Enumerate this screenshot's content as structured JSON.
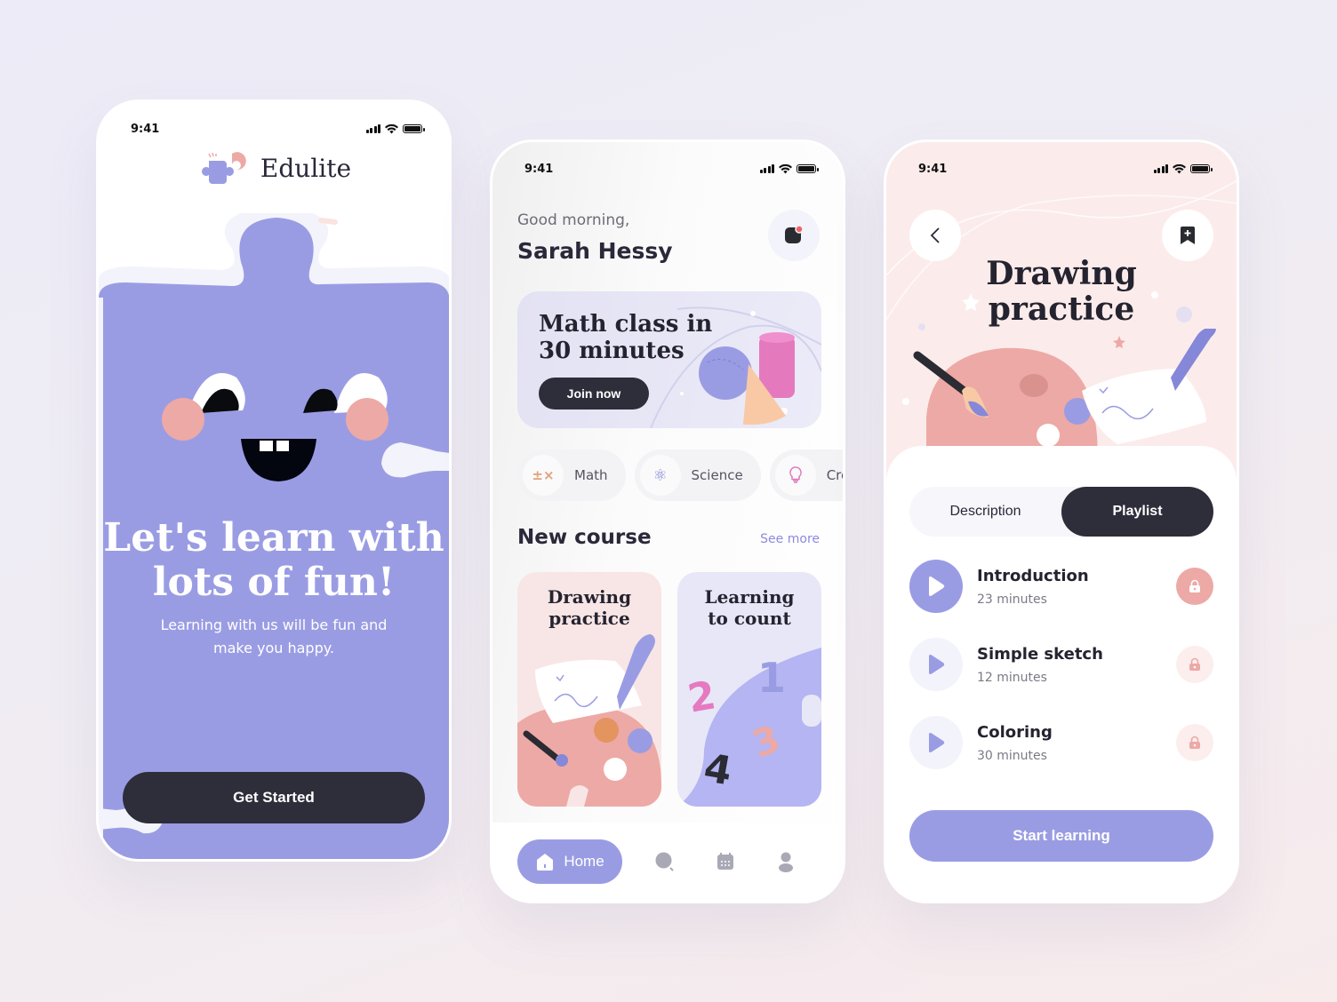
{
  "status_bar": {
    "time": "9:41"
  },
  "colors": {
    "accent": "#9a9ce3",
    "dark": "#2e2d3a",
    "blush": "#eda9a5",
    "pink": "#fbeceb"
  },
  "onboarding": {
    "brand": "Edulite",
    "headline_line1": "Let's learn with",
    "headline_line2": "lots of fun!",
    "subtitle_line1": "Learning with us will be fun and",
    "subtitle_line2": "make you happy.",
    "cta_label": "Get Started"
  },
  "home": {
    "greeting": "Good morning,",
    "user_name": "Sarah Hessy",
    "promo": {
      "title_line1": "Math class in",
      "title_line2": "30 minutes",
      "button_label": "Join now"
    },
    "categories": [
      {
        "label": "Math",
        "icon": "math-symbols-icon"
      },
      {
        "label": "Science",
        "icon": "atom-icon"
      },
      {
        "label": "Creat",
        "icon": "lightbulb-icon"
      }
    ],
    "section_title": "New course",
    "see_more_label": "See more",
    "courses": [
      {
        "title_line1": "Drawing",
        "title_line2": "practice"
      },
      {
        "title_line1": "Learning",
        "title_line2": "to count"
      }
    ],
    "nav": {
      "home_label": "Home",
      "items": [
        "search-icon",
        "calendar-icon",
        "profile-icon"
      ]
    }
  },
  "detail": {
    "title_line1": "Drawing",
    "title_line2": "practice",
    "tabs": [
      {
        "label": "Description",
        "active": false
      },
      {
        "label": "Playlist",
        "active": true
      }
    ],
    "lessons": [
      {
        "title": "Introduction",
        "duration": "23 minutes",
        "active": true
      },
      {
        "title": "Simple sketch",
        "duration": "12 minutes",
        "active": false
      },
      {
        "title": "Coloring",
        "duration": "30 minutes",
        "active": false
      }
    ],
    "cta_label": "Start learning"
  }
}
